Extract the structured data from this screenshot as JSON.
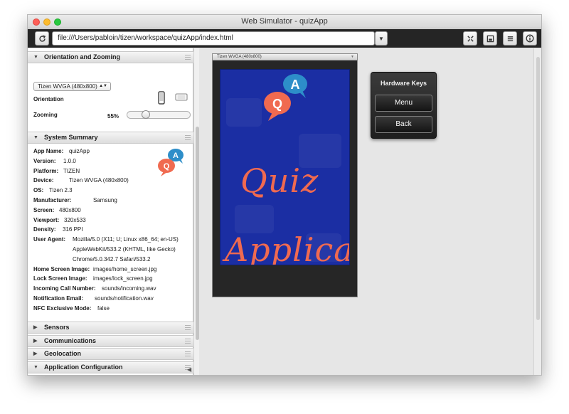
{
  "window": {
    "title": "Web Simulator - quizApp"
  },
  "toolbar": {
    "url": "file:///Users/pabloin/tizen/workspace/quizApp/index.html",
    "reload_icon": "reload-icon",
    "dropdown_icon": "chevron-down-icon",
    "right_icons": [
      "expand-icon",
      "save-icon",
      "list-icon",
      "info-icon"
    ]
  },
  "orientation": {
    "header": "Orientation and Zooming",
    "device_select": "Tizen WVGA (480x800)",
    "orientation_label": "Orientation",
    "zooming_label": "Zooming",
    "zoom_value": "55%",
    "zoom_level": 0.3
  },
  "summary": {
    "header": "System Summary",
    "rows": [
      {
        "label": "App Name:",
        "value": "quizApp"
      },
      {
        "label": "Version:",
        "value": "1.0.0"
      },
      {
        "label": "Platform:",
        "value": "TIZEN"
      },
      {
        "label": "Device:",
        "value": "Tizen WVGA (480x800)"
      },
      {
        "label": "OS:",
        "value": "Tizen 2.3"
      },
      {
        "label": "Manufacturer:",
        "value": "Samsung"
      },
      {
        "label": "Screen:",
        "value": "480x800"
      },
      {
        "label": "Viewport:",
        "value": "320x533"
      },
      {
        "label": "Density:",
        "value": "316 PPI"
      }
    ],
    "user_agent_label": "User Agent:",
    "user_agent_lines": [
      "Mozilla/5.0 (X11; U; Linux x86_64; en-US)",
      "AppleWebKit/533.2 (KHTML, like Gecko)",
      "Chrome/5.0.342.7 Safari/533.2"
    ],
    "rows2": [
      {
        "label": "Home Screen Image:",
        "value": "images/home_screen.jpg"
      },
      {
        "label": "Lock Screen Image:",
        "value": "images/lock_screen.jpg"
      },
      {
        "label": "Incoming Call Number:",
        "value": "sounds/incoming.wav"
      },
      {
        "label": "Notification Email:",
        "value": "sounds/notification.wav"
      },
      {
        "label": "NFC Exclusive Mode:",
        "value": "false"
      }
    ]
  },
  "sections": [
    "Sensors",
    "Communications",
    "Geolocation",
    "Application Configuration"
  ],
  "device": {
    "title": "Tizen WVGA (480x800)",
    "splash_word1": "Quiz",
    "splash_word2": "Applica",
    "bubble_a": "A",
    "bubble_q": "Q"
  },
  "hardware_keys": {
    "title": "Hardware Keys",
    "menu": "Menu",
    "back": "Back"
  },
  "colors": {
    "toolbar": "#252525",
    "screen": "#1b2ea3",
    "splash_text": "#f06a50",
    "bubble_q": "#f06a50",
    "bubble_a": "#2d8ec9"
  }
}
